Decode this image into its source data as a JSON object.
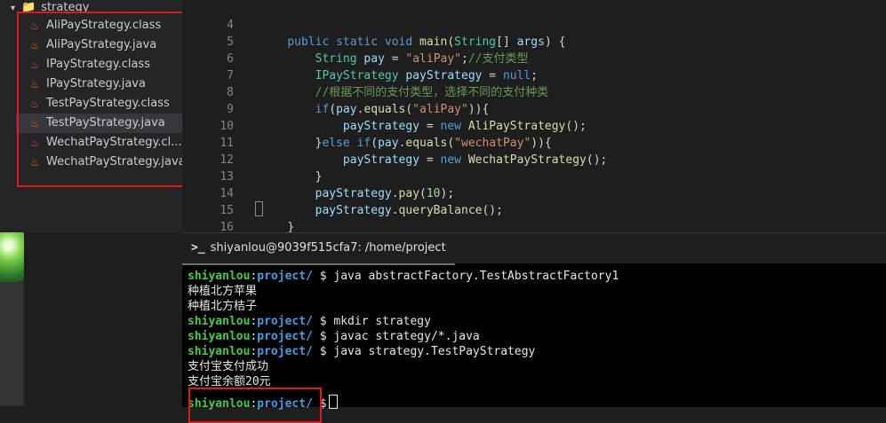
{
  "explorer": {
    "folder": "strategy",
    "files": [
      {
        "name": "AliPayStrategy.class",
        "type": "class"
      },
      {
        "name": "AliPayStrategy.java",
        "type": "java"
      },
      {
        "name": "IPayStrategy.class",
        "type": "class"
      },
      {
        "name": "IPayStrategy.java",
        "type": "java"
      },
      {
        "name": "TestPayStrategy.class",
        "type": "class"
      },
      {
        "name": "TestPayStrategy.java",
        "type": "java",
        "selected": true
      },
      {
        "name": "WechatPayStrategy.cl...",
        "type": "class"
      },
      {
        "name": "WechatPayStrategy.java",
        "type": "java"
      }
    ]
  },
  "editor": {
    "line_numbers": [
      "4",
      "5",
      "6",
      "7",
      "8",
      "9",
      "10",
      "11",
      "12",
      "13",
      "14",
      "15",
      "16"
    ],
    "lines": [
      "    public static void main(String[] args) {",
      "        String pay = \"aliPay\";//支付类型",
      "        IPayStrategy payStrategy = null;",
      "        //根据不同的支付类型，选择不同的支付种类",
      "        if(pay.equals(\"aliPay\")){",
      "            payStrategy = new AliPayStrategy();",
      "        }else if(pay.equals(\"wechatPay\")){",
      "            payStrategy = new WechatPayStrategy();",
      "        }",
      "        payStrategy.pay(10);",
      "        payStrategy.queryBalance();",
      "    }",
      "}"
    ]
  },
  "terminal": {
    "tab_title": "shiyanlou@9039f515cfa7: /home/project",
    "user": "shiyanlou",
    "dir": "project/",
    "prompt_symbol": "$",
    "commands": [
      "java abstractFactory.TestAbstractFactory1",
      "mkdir strategy",
      "javac strategy/*.java",
      "java strategy.TestPayStrategy"
    ],
    "outputs": {
      "factory": [
        "种植北方苹果",
        "种植北方桔子"
      ],
      "strategy": [
        "支付宝支付成功",
        "支付宝余额20元"
      ]
    }
  },
  "colors": {
    "highlight": "#e0191c",
    "user": "#3fcf3f",
    "dir": "#3aa0e6"
  },
  "icons": {
    "file_java": "java-file-icon",
    "file_class": "class-file-icon",
    "folder": "folder-icon",
    "terminal": "terminal-prompt-icon"
  }
}
